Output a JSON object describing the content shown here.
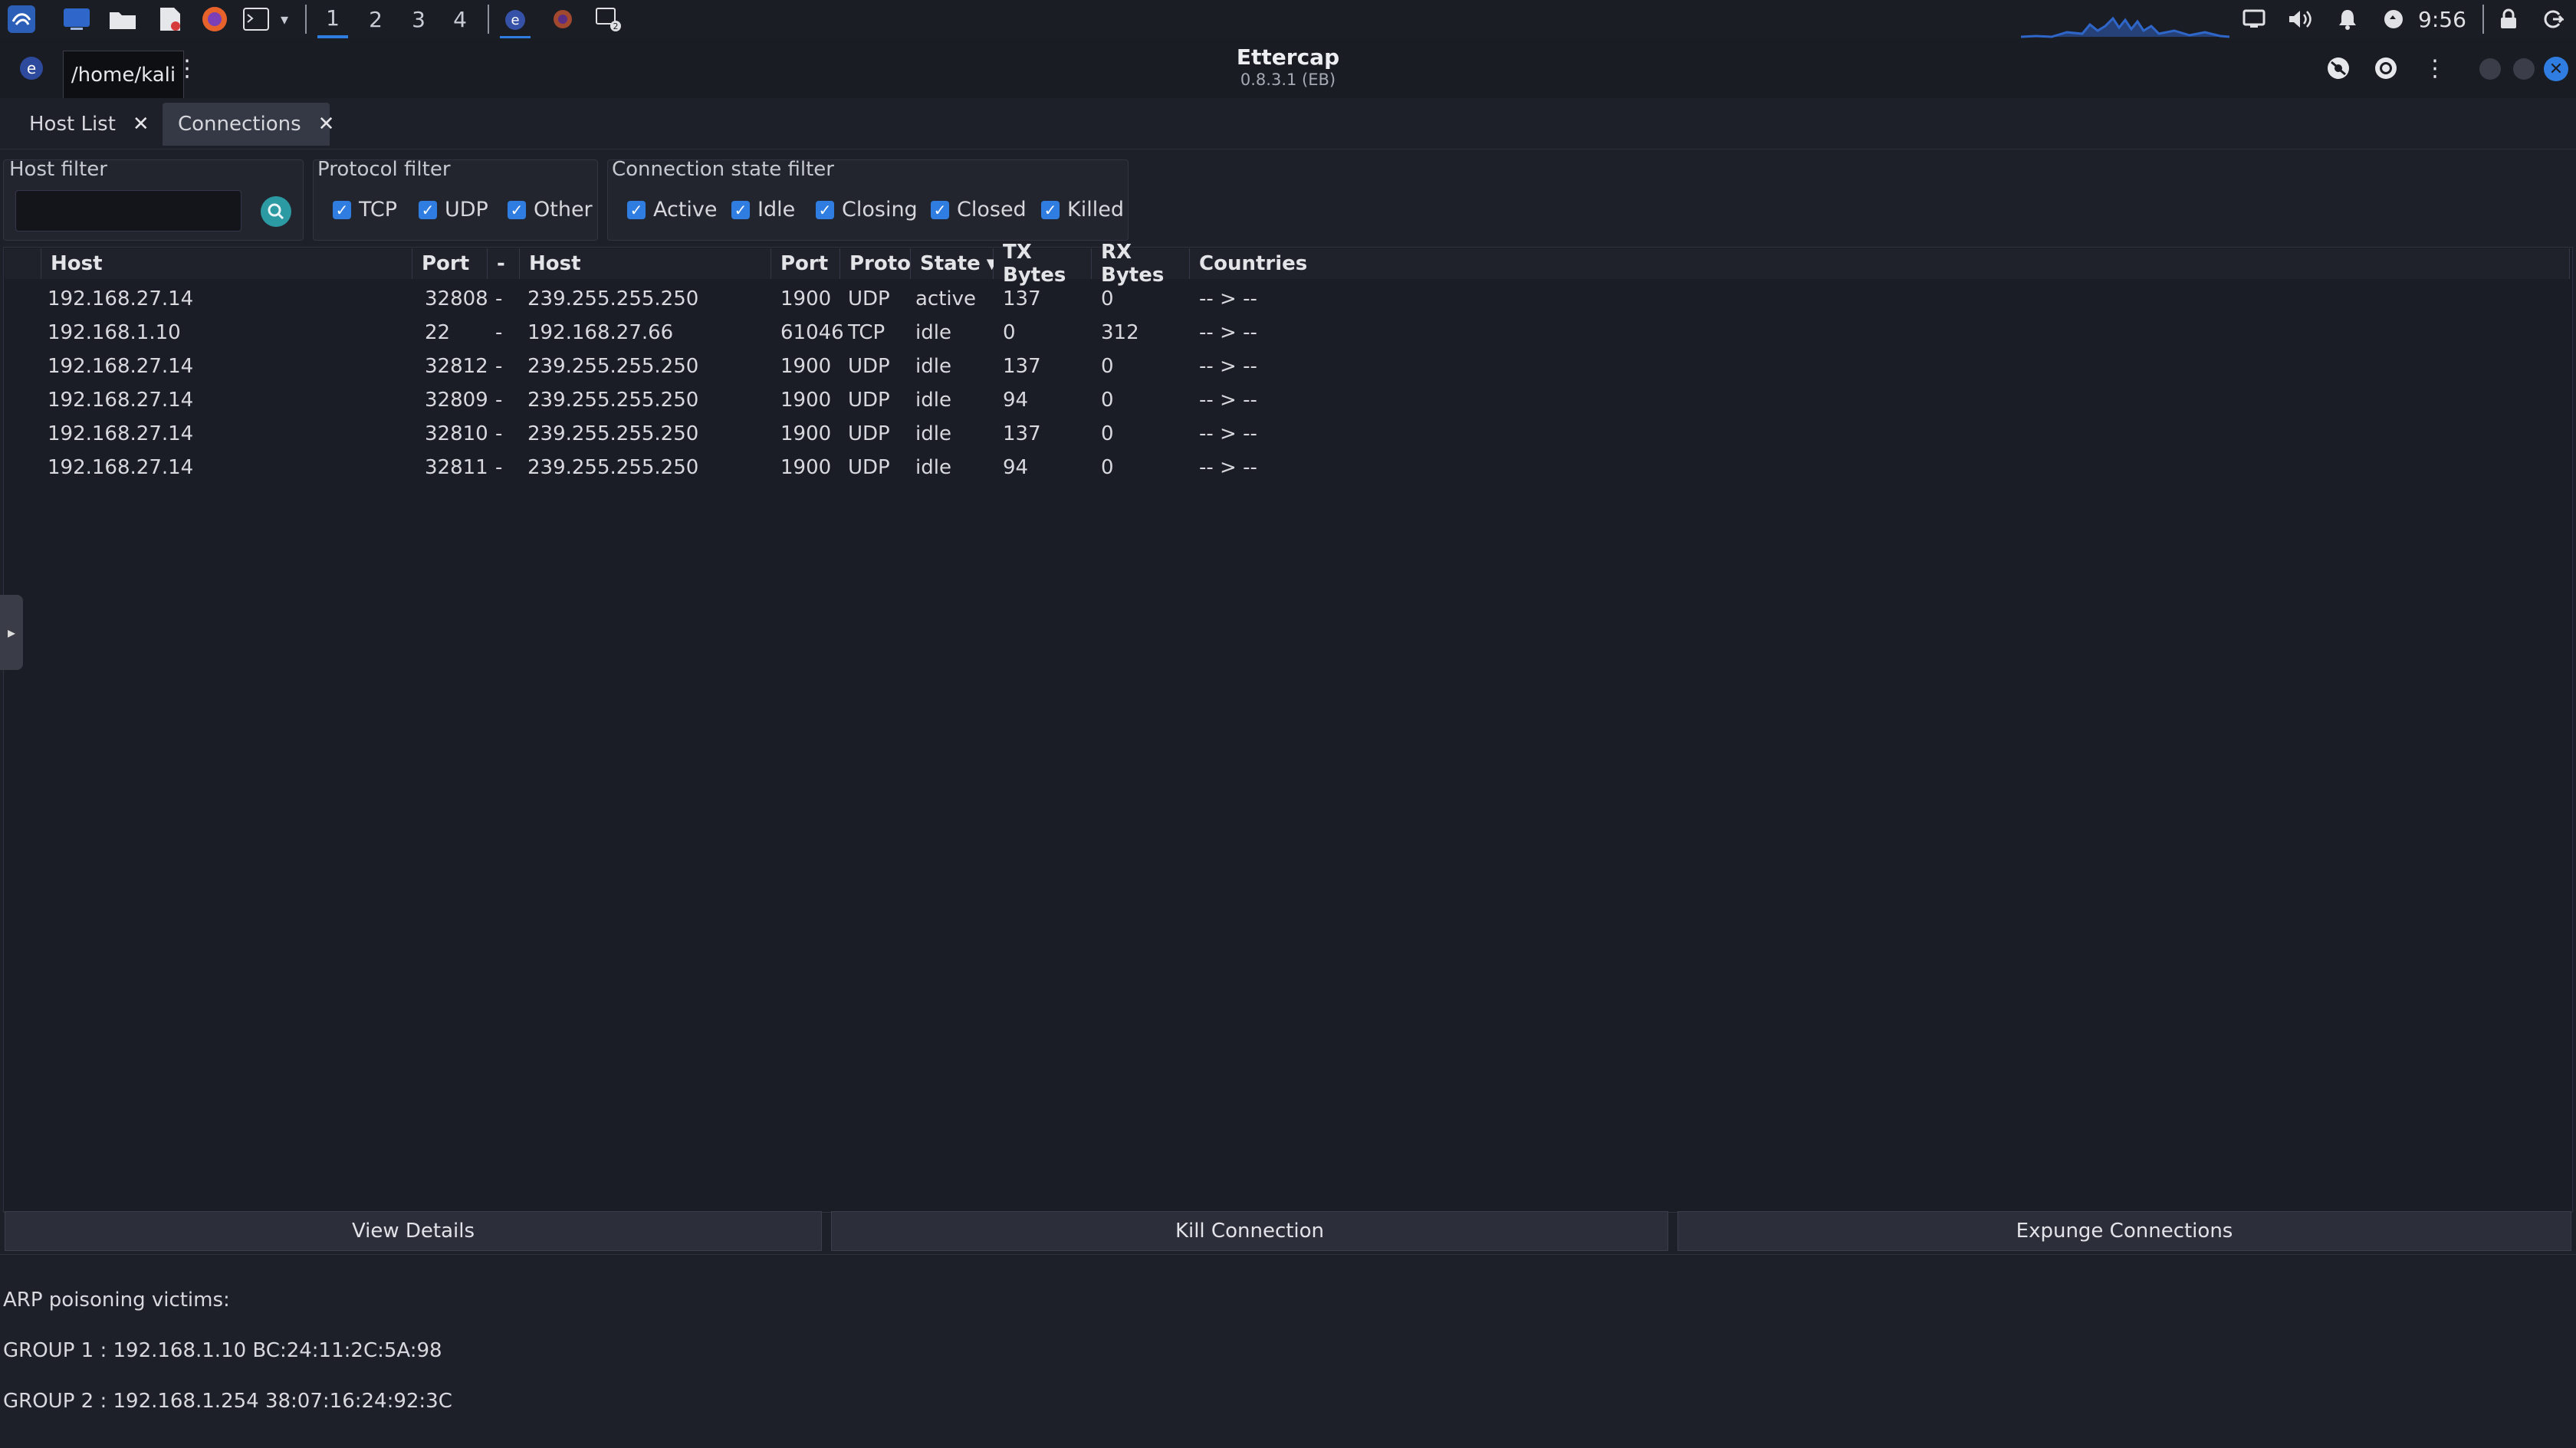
{
  "panel": {
    "workspaces": [
      "1",
      "2",
      "3",
      "4"
    ],
    "active_workspace": "1",
    "clock": "9:56"
  },
  "titlebar": {
    "title": "Ettercap",
    "subtitle": "0.8.3.1 (EB)",
    "tooltip": "/home/kali"
  },
  "tabs": [
    {
      "label": "Host List",
      "close": "✕"
    },
    {
      "label": "Connections",
      "close": "✕"
    }
  ],
  "filters": {
    "host_filter": {
      "title": "Host filter",
      "value": "",
      "placeholder": ""
    },
    "protocol_filter": {
      "title": "Protocol filter",
      "options": [
        "TCP",
        "UDP",
        "Other"
      ]
    },
    "state_filter": {
      "title": "Connection state filter",
      "options": [
        "Active",
        "Idle",
        "Closing",
        "Closed",
        "Killed"
      ]
    }
  },
  "table": {
    "columns": [
      "Host",
      "Port",
      "-",
      "Host",
      "Port",
      "Proto",
      "State",
      "TX Bytes",
      "RX Bytes",
      "Countries"
    ],
    "rows": [
      [
        "192.168.27.14",
        "32808",
        "-",
        "239.255.255.250",
        "1900",
        "UDP",
        "active",
        "137",
        "0",
        "-- > --"
      ],
      [
        "192.168.1.10",
        "22",
        "-",
        "192.168.27.66",
        "61046",
        "TCP",
        "idle",
        "0",
        "312",
        "-- > --"
      ],
      [
        "192.168.27.14",
        "32812",
        "-",
        "239.255.255.250",
        "1900",
        "UDP",
        "idle",
        "137",
        "0",
        "-- > --"
      ],
      [
        "192.168.27.14",
        "32809",
        "-",
        "239.255.255.250",
        "1900",
        "UDP",
        "idle",
        "94",
        "0",
        "-- > --"
      ],
      [
        "192.168.27.14",
        "32810",
        "-",
        "239.255.255.250",
        "1900",
        "UDP",
        "idle",
        "137",
        "0",
        "-- > --"
      ],
      [
        "192.168.27.14",
        "32811",
        "-",
        "239.255.255.250",
        "1900",
        "UDP",
        "idle",
        "94",
        "0",
        "-- > --"
      ]
    ]
  },
  "buttons": {
    "view_details": "View Details",
    "kill_connection": "Kill Connection",
    "expunge_connections": "Expunge Connections"
  },
  "log": {
    "lines": [
      "ARP poisoning victims:",
      "GROUP 1 : 192.168.1.10 BC:24:11:2C:5A:98",
      "GROUP 2 : 192.168.1.254 38:07:16:24:92:3C"
    ]
  },
  "colors": {
    "accent": "#2f7de1",
    "background": "#1e2029",
    "search_button": "#2b9aa3"
  }
}
